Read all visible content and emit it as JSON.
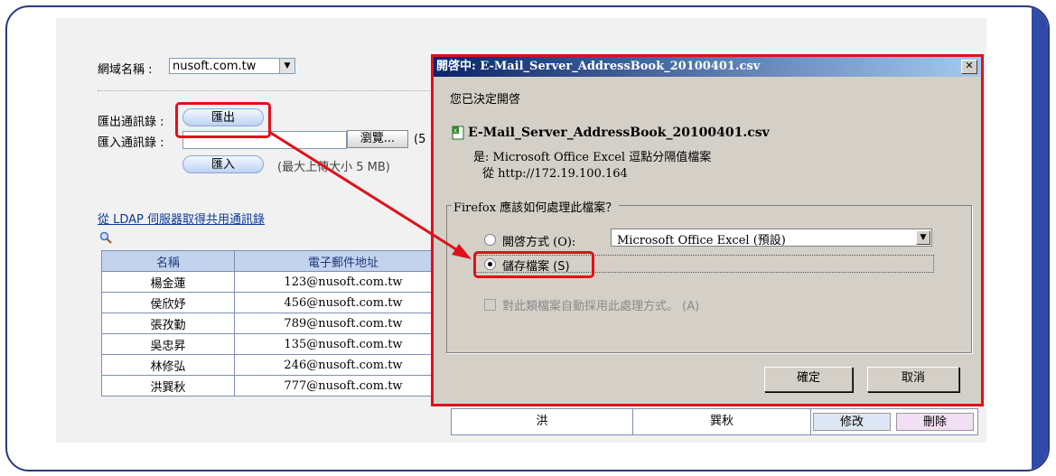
{
  "domain_field": {
    "label": "網域名稱 :",
    "value": "nusoft.com.tw"
  },
  "export": {
    "label": "匯出通訊錄 :",
    "button": "匯出"
  },
  "import": {
    "label": "匯入通訊錄 :",
    "browse_button": "瀏覽...",
    "import_button": "匯入",
    "size_note": "(最大上傳大小 5 MB)",
    "paren_fragment": "(5"
  },
  "ldap_link": "從 LDAP 伺服器取得共用通訊錄",
  "table": {
    "headers": [
      "名稱",
      "電子郵件地址"
    ],
    "rows": [
      {
        "name": "楊金蓮",
        "email": "123@nusoft.com.tw"
      },
      {
        "name": "侯欣妤",
        "email": "456@nusoft.com.tw"
      },
      {
        "name": "張孜勤",
        "email": "789@nusoft.com.tw"
      },
      {
        "name": "吳忠昇",
        "email": "135@nusoft.com.tw"
      },
      {
        "name": "林修弘",
        "email": "246@nusoft.com.tw"
      },
      {
        "name": "洪巽秋",
        "email": "777@nusoft.com.tw",
        "last": "洪",
        "first": "巽秋",
        "edit": "修改",
        "delete": "刪除"
      }
    ]
  },
  "dialog": {
    "title": "開啓中: E-Mail_Server_AddressBook_20100401.csv",
    "close": "✕",
    "intro": "您已決定開啓",
    "filename": "E-Mail_Server_AddressBook_20100401.csv",
    "type_line": "是: Microsoft Office Excel 逗點分隔值檔案",
    "from_line": "從   http://172.19.100.164",
    "group_title": "Firefox 應該如何處理此檔案？",
    "open_with_label": "開啓方式 (O):",
    "open_with_value": "Microsoft Office Excel (預設)",
    "save_label": "儲存檔案 (S)",
    "auto_label": "對此類檔案自動採用此處理方式。 (A)",
    "ok": "確定",
    "cancel": "取消"
  }
}
